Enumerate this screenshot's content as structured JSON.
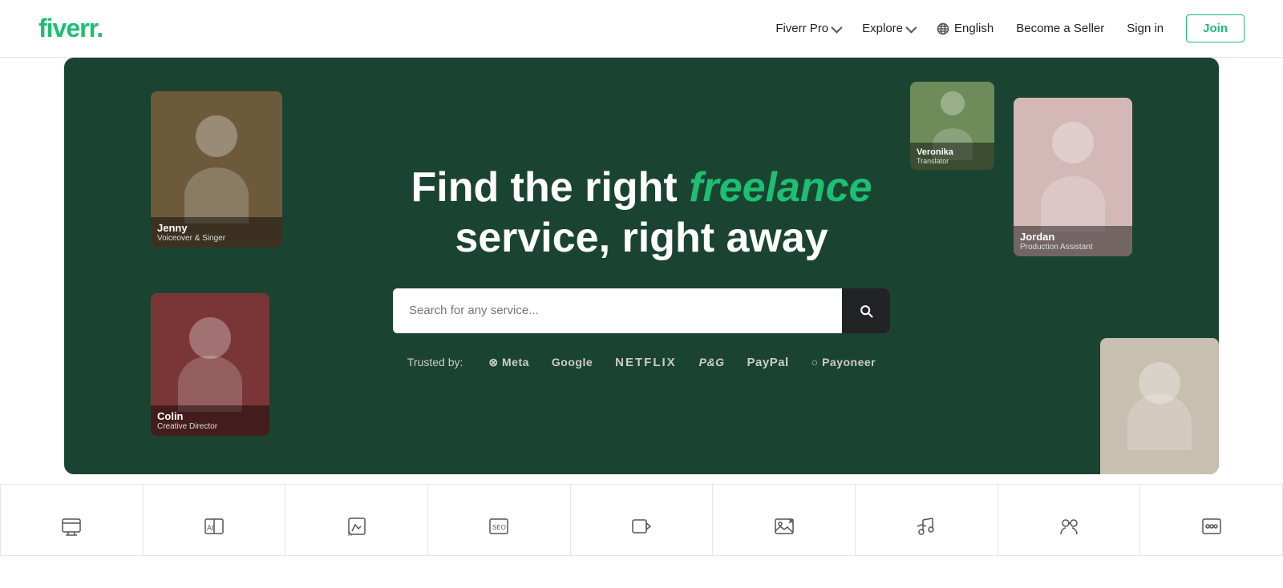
{
  "navbar": {
    "logo_text": "fiverr",
    "logo_dot": ".",
    "fiverr_pro_label": "Fiverr Pro",
    "explore_label": "Explore",
    "language_label": "English",
    "become_seller_label": "Become a Seller",
    "sign_in_label": "Sign in",
    "join_label": "Join"
  },
  "hero": {
    "title_part1": "Find the right ",
    "title_accent": "freelance",
    "title_part2": " service, right away",
    "search_placeholder": "Search for any service...",
    "trusted_label": "Trusted by:",
    "trusted_logos": [
      {
        "name": "Meta",
        "display": "⊗ Meta",
        "class": ""
      },
      {
        "name": "Google",
        "display": "Google",
        "class": ""
      },
      {
        "name": "NETFLIX",
        "display": "NETFLIX",
        "class": "netflix"
      },
      {
        "name": "P&G",
        "display": "P&G",
        "class": "pg"
      },
      {
        "name": "PayPal",
        "display": "PayPal",
        "class": "paypal"
      },
      {
        "name": "Payoneer",
        "display": "○ Payoneer",
        "class": ""
      }
    ],
    "cards": [
      {
        "id": "jenny",
        "name": "Jenny",
        "role": "Voiceover & Singer"
      },
      {
        "id": "jordan",
        "name": "Jordan",
        "role": "Production Assistant"
      },
      {
        "id": "colin",
        "name": "Colin",
        "role": "Creative Director"
      },
      {
        "id": "veronika",
        "name": "Veronika",
        "role": "Translator"
      }
    ]
  },
  "categories": [
    {
      "id": "website-dev",
      "label": ""
    },
    {
      "id": "ai-art",
      "label": ""
    },
    {
      "id": "logo-design",
      "label": ""
    },
    {
      "id": "seo",
      "label": ""
    },
    {
      "id": "video",
      "label": ""
    },
    {
      "id": "photo-editing",
      "label": ""
    },
    {
      "id": "music",
      "label": ""
    },
    {
      "id": "virtual-assistant",
      "label": ""
    },
    {
      "id": "social-media",
      "label": ""
    }
  ]
}
